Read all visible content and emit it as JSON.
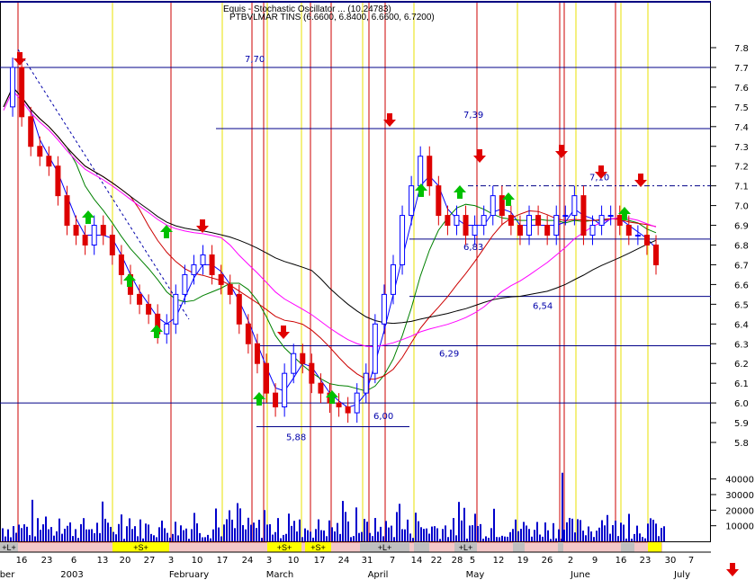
{
  "header": {
    "line1": "Equis - Stochastic Oscillator ... (10.24783)",
    "line2": "PTBVLMAR TINS (6.6600, 6.8400, 6.6600, 6.7200)"
  },
  "chart_data": {
    "type": "candlestick",
    "title": "PTBVLMAR TINS (6.6600, 6.8400, 6.6600, 6.7200)",
    "price_axis": {
      "min": 5.8,
      "max": 7.8,
      "ticks": [
        "5.8",
        "5.9",
        "6.0",
        "6.1",
        "6.2",
        "6.3",
        "6.4",
        "6.5",
        "6.6",
        "6.7",
        "6.8",
        "6.9",
        "7.0",
        "7.1",
        "7.2",
        "7.3",
        "7.4",
        "7.5",
        "7.6",
        "7.7",
        "7.8"
      ]
    },
    "volume_axis": {
      "min": 0,
      "max": 45000,
      "ticks": [
        "10000",
        "20000",
        "30000",
        "40000"
      ]
    },
    "x_axis": {
      "month_labels": [
        "ber",
        "2003",
        "February",
        "March",
        "April",
        "May",
        "June",
        "July"
      ],
      "day_labels": [
        "16",
        "23",
        "6",
        "13",
        "20",
        "27",
        "3",
        "10",
        "17",
        "24",
        "3",
        "10",
        "17",
        "24",
        "31",
        "7",
        "14",
        "22",
        "28",
        "5",
        "12",
        "19",
        "26",
        "2",
        "9",
        "16",
        "23",
        "30",
        "7"
      ]
    },
    "level_lines": [
      {
        "value": 7.7,
        "label": "7,70"
      },
      {
        "value": 7.39,
        "label": "7,39"
      },
      {
        "value": 7.1,
        "label": "7,10"
      },
      {
        "value": 6.83,
        "label": "6,83"
      },
      {
        "value": 6.54,
        "label": "6,54"
      },
      {
        "value": 6.29,
        "label": "6,29"
      },
      {
        "value": 6.0,
        "label": "6,00"
      },
      {
        "value": 5.88,
        "label": "5,88"
      }
    ],
    "signal_band": [
      "+L+",
      "+S+",
      "+S+",
      "+S+",
      "+L+",
      "+L+"
    ],
    "series": [
      {
        "name": "Close",
        "values": [
          7.5,
          7.7,
          7.45,
          7.3,
          7.25,
          7.2,
          7.05,
          6.9,
          6.85,
          6.8,
          6.9,
          6.85,
          6.75,
          6.65,
          6.55,
          6.5,
          6.45,
          6.35,
          6.4,
          6.55,
          6.65,
          6.7,
          6.75,
          6.65,
          6.6,
          6.55,
          6.4,
          6.3,
          6.2,
          6.05,
          5.98,
          6.15,
          6.25,
          6.2,
          6.1,
          6.05,
          6.0,
          5.98,
          5.95,
          6.05,
          6.15,
          6.4,
          6.55,
          6.7,
          6.95,
          7.1,
          7.25,
          7.1,
          6.95,
          6.9,
          6.95,
          6.85,
          6.9,
          6.95,
          7.05,
          6.95,
          6.9,
          6.85,
          6.95,
          6.9,
          6.85,
          6.95,
          6.95,
          7.05,
          6.85,
          6.9,
          6.95,
          6.95,
          6.9,
          6.85,
          6.85,
          6.8,
          6.7
        ]
      }
    ]
  }
}
